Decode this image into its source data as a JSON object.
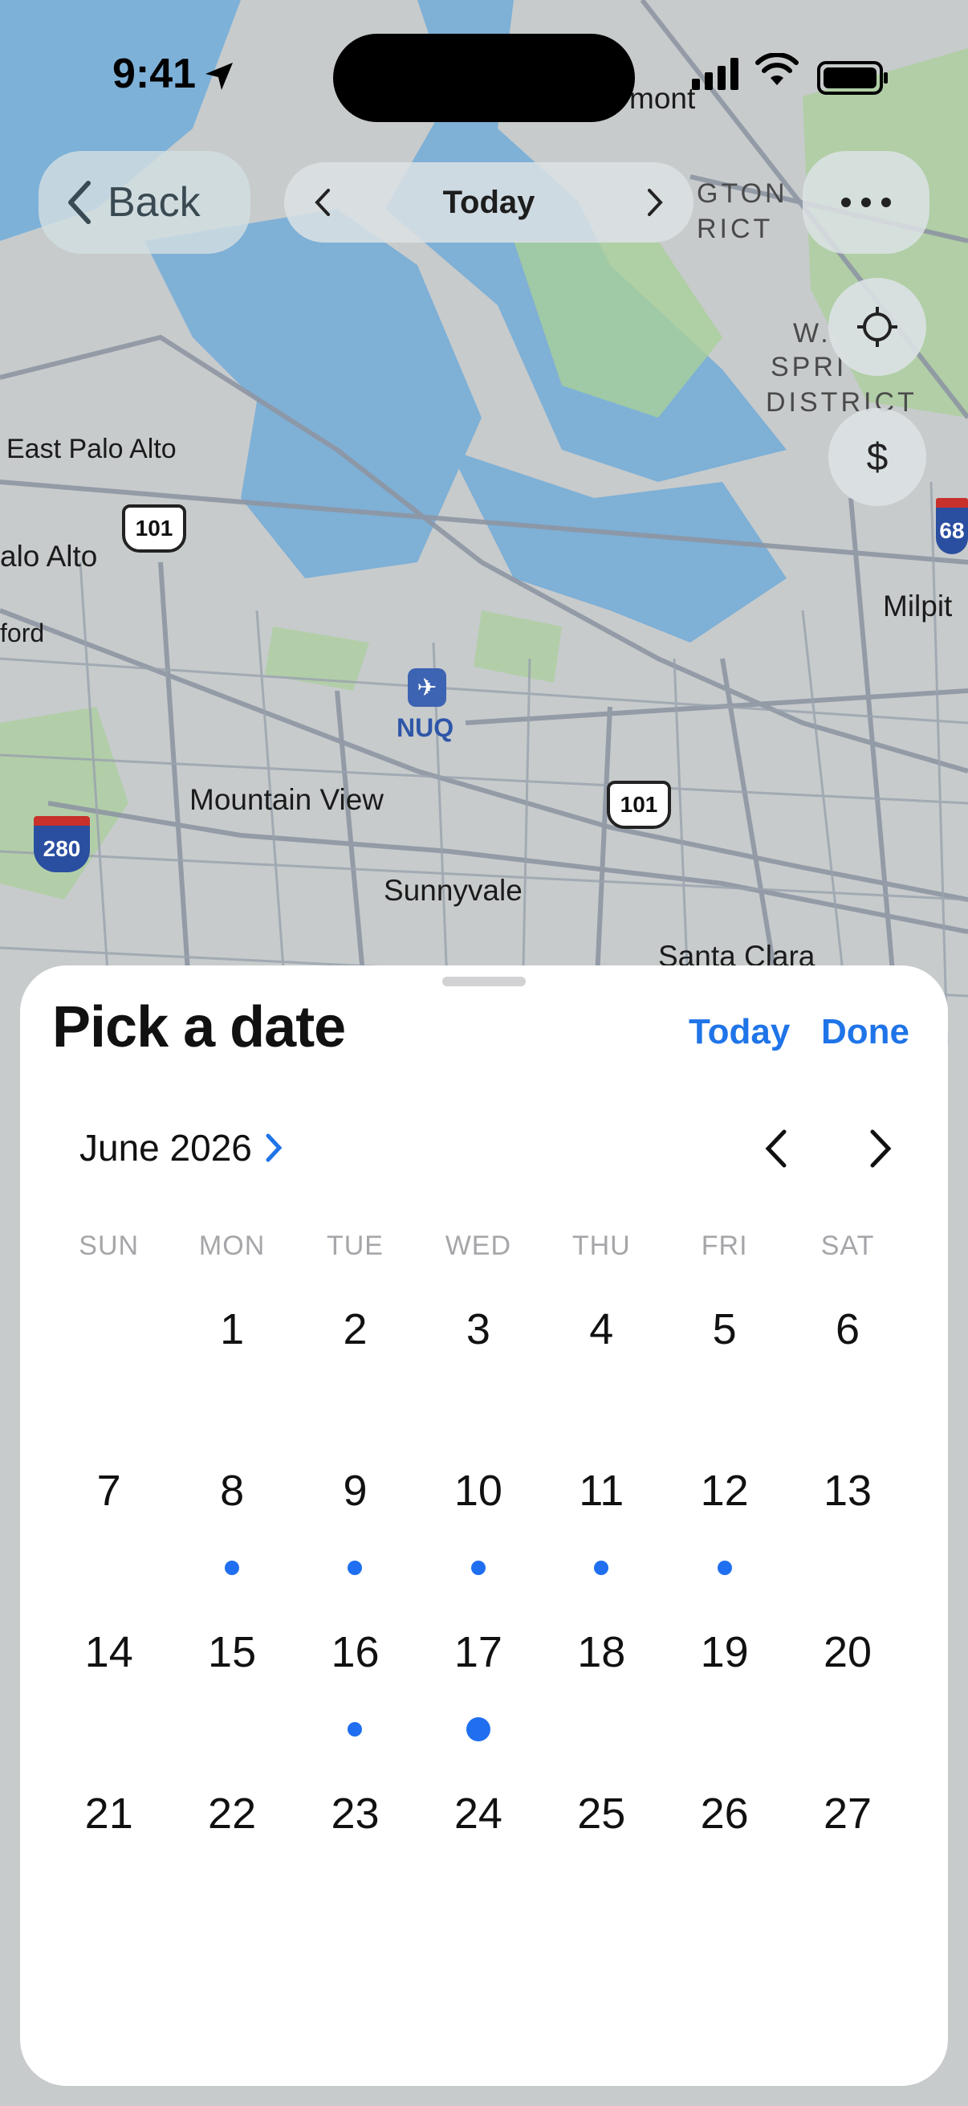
{
  "status_bar": {
    "time": "9:41"
  },
  "top_bar": {
    "back_label": "Back",
    "date_label": "Today"
  },
  "map_labels": {
    "east_palo_alto": "East Palo Alto",
    "palo_alto": "alo Alto",
    "ford": "ford",
    "mountain_view": "Mountain View",
    "sunnyvale": "Sunnyvale",
    "santa_clara": "Santa Clara",
    "nuq": "NUQ",
    "milpitas": "Milpit",
    "fremont": "mont",
    "district_1": "GTON",
    "district_2": "RICT",
    "springs_1": "W.",
    "springs_2": "SPRI",
    "springs_3": "DISTRICT",
    "hwy_101_a": "101",
    "hwy_101_b": "101",
    "i280": "280",
    "i680": "68"
  },
  "sheet": {
    "title": "Pick a date",
    "today_link": "Today",
    "done_link": "Done",
    "month_label": "June 2026",
    "weekdays": [
      "SUN",
      "MON",
      "TUE",
      "WED",
      "THU",
      "FRI",
      "SAT"
    ],
    "weeks": [
      [
        "",
        "1",
        "2",
        "3",
        "4",
        "5",
        "6"
      ],
      [
        "7",
        "8",
        "9",
        "10",
        "11",
        "12",
        "13"
      ],
      [
        "14",
        "15",
        "16",
        "17",
        "18",
        "19",
        "20"
      ],
      [
        "21",
        "22",
        "23",
        "24",
        "25",
        "26",
        "27"
      ]
    ],
    "event_days": [
      "8",
      "9",
      "10",
      "11",
      "12",
      "16"
    ],
    "highlighted_event_day": "17"
  },
  "colors": {
    "accent": "#1f74e8",
    "dot": "#1f6ff0",
    "water": "#7fb0d6",
    "park": "#a9cf9a"
  }
}
